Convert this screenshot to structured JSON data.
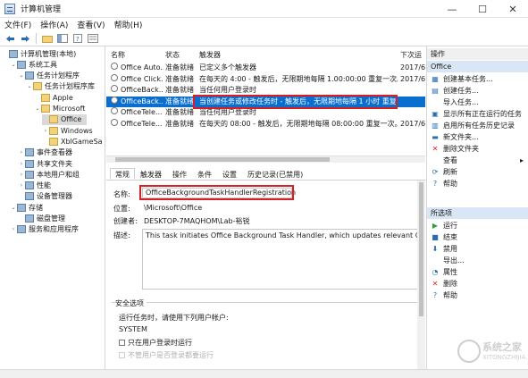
{
  "window": {
    "title": "计算机管理",
    "min": "—",
    "max": "☐",
    "close": "✕"
  },
  "menu": [
    "文件(F)",
    "操作(A)",
    "查看(V)",
    "帮助(H)"
  ],
  "tree": [
    {
      "label": "计算机管理(本地)",
      "level": 0,
      "twisty": ""
    },
    {
      "label": "系统工具",
      "level": 1,
      "twisty": "⌄"
    },
    {
      "label": "任务计划程序",
      "level": 2,
      "twisty": "⌄"
    },
    {
      "label": "任务计划程序库",
      "level": 3,
      "twisty": "⌄"
    },
    {
      "label": "Apple",
      "level": 4,
      "twisty": ""
    },
    {
      "label": "Microsoft",
      "level": 4,
      "twisty": "⌄"
    },
    {
      "label": "Office",
      "level": 5,
      "twisty": "",
      "selected": true
    },
    {
      "label": "Windows",
      "level": 5,
      "twisty": "›"
    },
    {
      "label": "XblGameSa",
      "level": 5,
      "twisty": ""
    },
    {
      "label": "事件查看器",
      "level": 2,
      "twisty": "›"
    },
    {
      "label": "共享文件夹",
      "level": 2,
      "twisty": "›"
    },
    {
      "label": "本地用户和组",
      "level": 2,
      "twisty": "›"
    },
    {
      "label": "性能",
      "level": 2,
      "twisty": "›"
    },
    {
      "label": "设备管理器",
      "level": 2,
      "twisty": ""
    },
    {
      "label": "存储",
      "level": 1,
      "twisty": "⌄"
    },
    {
      "label": "磁盘管理",
      "level": 2,
      "twisty": ""
    },
    {
      "label": "服务和应用程序",
      "level": 1,
      "twisty": "›"
    }
  ],
  "task_table": {
    "columns": [
      "名称",
      "状态",
      "触发器",
      "下次运"
    ],
    "rows": [
      {
        "name": "Office Auto...",
        "status": "准备就绪",
        "trigger": "已定义多个触发器",
        "next": "2017/6"
      },
      {
        "name": "Office Click...",
        "status": "准备就绪",
        "trigger": "在每天的 4:00 - 触发后，无限期地每隔 1.00:00:00 重复一次。",
        "next": "2017/6"
      },
      {
        "name": "OfficeBack...",
        "status": "准备就绪",
        "trigger": "当任何用户登录时",
        "next": ""
      },
      {
        "name": "OfficeBack...",
        "status": "准备就绪",
        "trigger": "当创建任务或修改任务时 - 触发后，无限期地每隔 1 小时 重复一次。",
        "next": "",
        "selected": true
      },
      {
        "name": "OfficeTele...",
        "status": "准备就绪",
        "trigger": "当任何用户登录时",
        "next": ""
      },
      {
        "name": "OfficeTele...",
        "status": "准备就绪",
        "trigger": "在每天的 08:00 - 触发后，无限期地每隔 08:00:00 重复一次。",
        "next": "2017/6"
      }
    ]
  },
  "detail_tabs": [
    "常规",
    "触发器",
    "操作",
    "条件",
    "设置",
    "历史记录(已禁用)"
  ],
  "details": {
    "name_label": "名称:",
    "name_value": "OfficeBackgroundTaskHandlerRegistration",
    "location_label": "位置:",
    "location_value": "\\Microsoft\\Office",
    "author_label": "创建者:",
    "author_value": "DESKTOP-7MAQHOM\\Lab-裕锐",
    "desc_label": "描述:",
    "desc_value": "This task initiates Office Background Task Handler, which updates relevant Office da",
    "security_label": "安全选项",
    "run_as_label": "运行任务时，请使用下列用户帐户:",
    "run_as_value": "SYSTEM",
    "option_logged_on": "只在用户登录时运行",
    "option_regardless": "不管用户是否登录都要运行"
  },
  "actions": {
    "header": "操作",
    "section1": "Office",
    "items1": [
      {
        "label": "创建基本任务...",
        "icon": "create-basic-task-icon",
        "glyph": "▦"
      },
      {
        "label": "创建任务...",
        "icon": "create-task-icon",
        "glyph": "▤"
      },
      {
        "label": "导入任务...",
        "icon": "",
        "glyph": ""
      },
      {
        "label": "显示所有正在运行的任务",
        "icon": "running-tasks-icon",
        "glyph": "▣"
      },
      {
        "label": "启用所有任务历史记录",
        "icon": "history-icon",
        "glyph": "▥"
      },
      {
        "label": "新文件夹...",
        "icon": "new-folder-icon",
        "glyph": "▬"
      },
      {
        "label": "删除文件夹",
        "icon": "delete-x-icon",
        "glyph": "✕"
      },
      {
        "label": "查看",
        "icon": "",
        "glyph": "",
        "arrow": "▸"
      },
      {
        "label": "刷新",
        "icon": "refresh-icon",
        "glyph": "⟳"
      },
      {
        "label": "帮助",
        "icon": "help-icon",
        "glyph": "?"
      }
    ],
    "section2": "所选项",
    "items2": [
      {
        "label": "运行",
        "icon": "run-icon",
        "glyph": "▶"
      },
      {
        "label": "结束",
        "icon": "end-icon",
        "glyph": "■"
      },
      {
        "label": "禁用",
        "icon": "disable-icon",
        "glyph": "⬇"
      },
      {
        "label": "导出...",
        "icon": "",
        "glyph": ""
      },
      {
        "label": "属性",
        "icon": "properties-icon",
        "glyph": "◔"
      },
      {
        "label": "删除",
        "icon": "delete-x-icon",
        "glyph": "✕"
      },
      {
        "label": "帮助",
        "icon": "help-icon",
        "glyph": "?"
      }
    ]
  },
  "watermark": {
    "text": "系统之家",
    "url": "XITONGZHIJIA.NET"
  },
  "colors": {
    "selection": "#0a6ecf",
    "highlight_box": "#d71f26",
    "action_header": "#d9e6f5"
  }
}
